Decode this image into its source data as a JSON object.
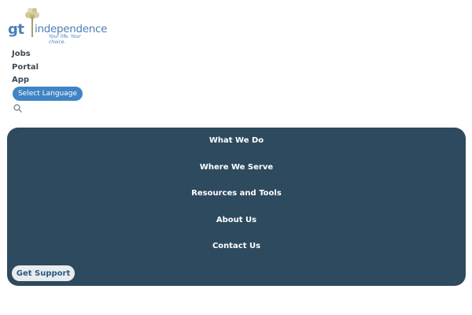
{
  "logo": {
    "mark": "gt",
    "name": "independence",
    "tagline": "Your life. Your choice."
  },
  "top_links": [
    "Jobs",
    "Portal",
    "App"
  ],
  "language_button": "Select Language",
  "main_nav": [
    "What We Do",
    "Where We Serve",
    "Resources and Tools",
    "About Us",
    "Contact Us"
  ],
  "support_button": "Get Support",
  "colors": {
    "brand_blue": "#4a7fb5",
    "panel": "#2d4a5f",
    "button_blue": "#3f84c4"
  }
}
